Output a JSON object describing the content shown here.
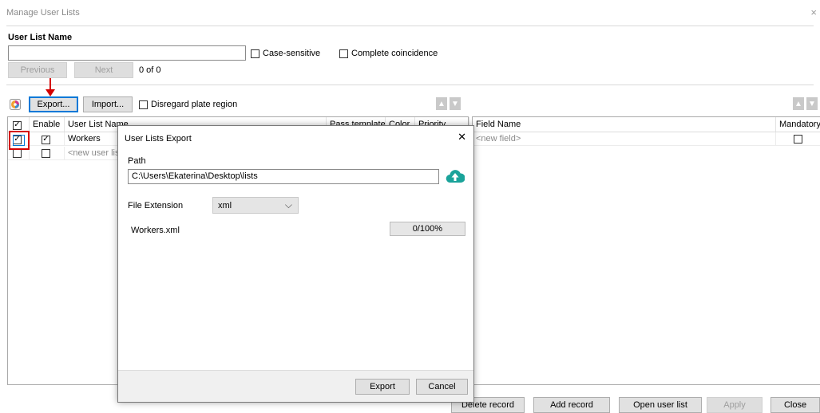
{
  "window": {
    "title": "Manage User Lists",
    "close_glyph": "×"
  },
  "search": {
    "label": "User List Name",
    "value": "",
    "case_sensitive": "Case-sensitive",
    "complete_coincidence": "Complete coincidence",
    "previous": "Previous",
    "next": "Next",
    "counter": "0 of 0"
  },
  "toolbar": {
    "export": "Export...",
    "import": "Import...",
    "disregard_plate_region": "Disregard plate region"
  },
  "lists_table": {
    "columns": [
      "Enable",
      "User List Name",
      "Pass template",
      "Color",
      "Priority"
    ],
    "rows": [
      {
        "name": "Workers",
        "selected": true,
        "enabled": true
      },
      {
        "name": "<new user list>",
        "selected": false,
        "enabled": false
      }
    ]
  },
  "fields_table": {
    "columns": [
      "Field Name",
      "Mandatory"
    ],
    "rows": [
      {
        "name": "<new field>",
        "mandatory": false
      }
    ]
  },
  "bottom_buttons": {
    "delete_record": "Delete record",
    "add_record": "Add record",
    "open_user_list": "Open user list",
    "apply": "Apply",
    "close": "Close"
  },
  "dialog": {
    "title": "User Lists Export",
    "close_glyph": "✕",
    "path_label": "Path",
    "path_value": "C:\\Users\\Ekaterina\\Desktop\\lists",
    "file_extension_label": "File Extension",
    "file_extension_value": "xml",
    "file_name": "Workers.xml",
    "progress_text": "0/100%",
    "progress_fraction": 0.0,
    "export": "Export",
    "cancel": "Cancel"
  },
  "colors": {
    "annotation_red": "#d40000",
    "focus_blue": "#0078d7",
    "upload_icon_teal": "#1aa39a"
  },
  "icons": [
    "color-palette-icon",
    "arrow-up-icon",
    "arrow-down-icon",
    "cloud-upload-icon",
    "chevron-down-icon",
    "close-icon",
    "annotation-arrow"
  ]
}
